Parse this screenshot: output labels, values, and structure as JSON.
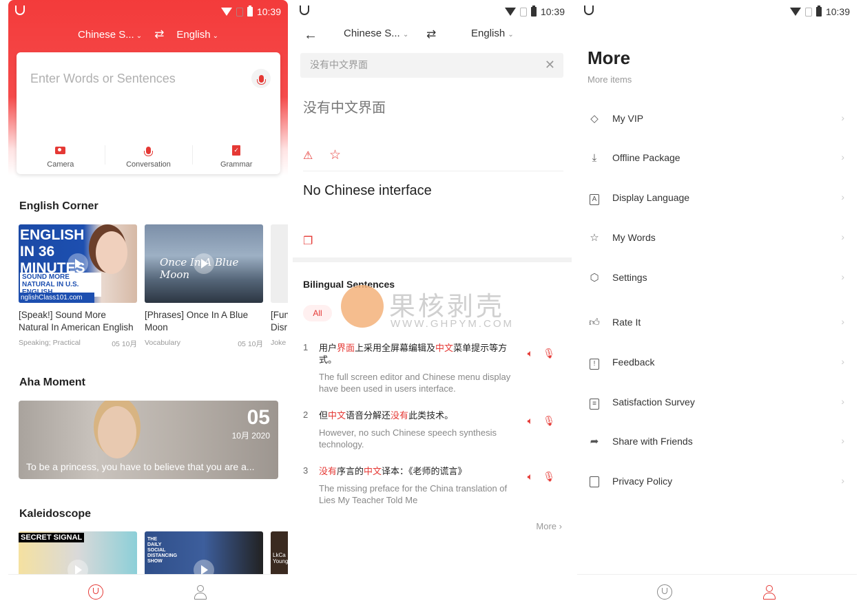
{
  "status": {
    "time": "10:39"
  },
  "colors": {
    "accent": "#e53935",
    "hero": "#f33b3b"
  },
  "home": {
    "source_lang": "Chinese S...",
    "target_lang": "English",
    "input_placeholder": "Enter Words or Sentences",
    "tools": [
      {
        "label": "Camera",
        "icon": "camera-icon"
      },
      {
        "label": "Conversation",
        "icon": "mic-icon"
      },
      {
        "label": "Grammar",
        "icon": "grammar-icon"
      }
    ],
    "english_corner": {
      "title": "English Corner",
      "videos": [
        {
          "thumb_text": "ENGLISH IN 36 MINUTES",
          "thumb_sub": "SOUND MORE NATURAL IN U.S. ENGLISH",
          "thumb_url": "nglishClass101.com",
          "title": "[Speak!] Sound More Natural In American English",
          "tags": "Speaking; Practical",
          "date": "05 10月"
        },
        {
          "thumb_text": "Once In A Blue Moon",
          "title": "[Phrases] Once In A Blue Moon",
          "tags": "Vocabulary",
          "date": "05 10月"
        },
        {
          "title": "[Fun Disr",
          "tags": "Joke"
        }
      ]
    },
    "aha": {
      "title": "Aha Moment",
      "day": "05",
      "month_year": "10月 2020",
      "caption": "To be a princess, you have to believe that you are a..."
    },
    "kaleidoscope": {
      "title": "Kaleidoscope",
      "thumb1_label": "SECRET SIGNAL",
      "thumb2_label": "THE DAILY SOCIAL DISTANCING SHOW",
      "thumb3_label": "LkCa Young"
    }
  },
  "translate": {
    "source_lang": "Chinese S...",
    "target_lang": "English",
    "query": "没有中文界面",
    "source_text": "没有中文界面",
    "translation": "No Chinese interface",
    "bilingual_title": "Bilingual Sentences",
    "filter_all": "All",
    "sentences": [
      {
        "num": "1",
        "zh_parts": [
          [
            "用户",
            false
          ],
          [
            "界面",
            true
          ],
          [
            "上采用全屏幕编辑及",
            false
          ],
          [
            "中文",
            true
          ],
          [
            "菜单提示等方式。",
            false
          ]
        ],
        "en": "The full screen editor and Chinese menu display have been used in users interface."
      },
      {
        "num": "2",
        "zh_parts": [
          [
            "但",
            false
          ],
          [
            "中文",
            true
          ],
          [
            "语音分解还",
            false
          ],
          [
            "没有",
            true
          ],
          [
            "此类技术。",
            false
          ]
        ],
        "en": "However, no such Chinese speech synthesis technology."
      },
      {
        "num": "3",
        "zh_parts": [
          [
            "没有",
            true
          ],
          [
            "序言的",
            false
          ],
          [
            "中文",
            true
          ],
          [
            "译本：《老师的谎言》",
            false
          ]
        ],
        "en": "The missing preface for the China translation of Lies My Teacher Told Me"
      }
    ],
    "more_label": "More",
    "watermark_big": "果核剥壳",
    "watermark_small": "WWW.GHPYM.COM"
  },
  "more": {
    "title": "More",
    "subtitle": "More items",
    "items": [
      {
        "label": "My VIP",
        "icon": "diamond-icon"
      },
      {
        "label": "Offline Package",
        "icon": "download-icon"
      },
      {
        "label": "Display Language",
        "icon": "language-icon"
      },
      {
        "label": "My Words",
        "icon": "folder-star-icon"
      },
      {
        "label": "Settings",
        "icon": "gear-icon"
      },
      {
        "label": "Rate It",
        "icon": "thumbs-up-icon"
      },
      {
        "label": "Feedback",
        "icon": "feedback-icon"
      },
      {
        "label": "Satisfaction Survey",
        "icon": "clipboard-icon"
      },
      {
        "label": "Share with Friends",
        "icon": "share-icon"
      },
      {
        "label": "Privacy Policy",
        "icon": "document-icon"
      }
    ]
  }
}
